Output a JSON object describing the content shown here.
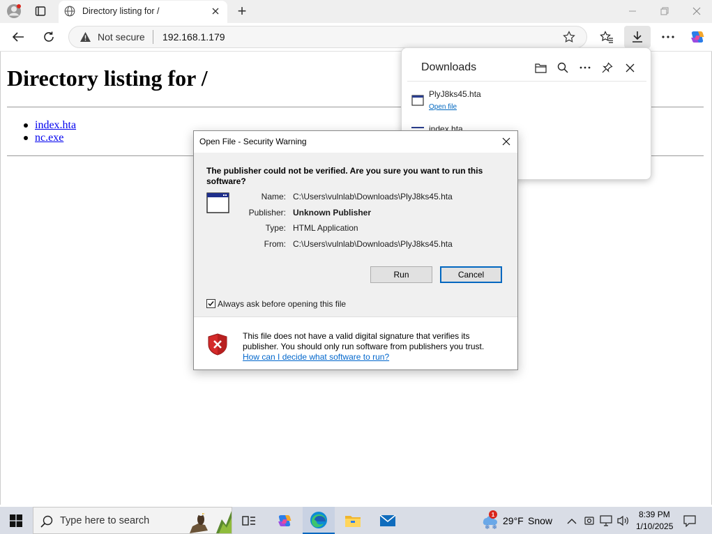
{
  "browser": {
    "tab_title": "Directory listing for /",
    "security_label": "Not secure",
    "url": "192.168.1.179",
    "new_tab_symbol": "+",
    "window_controls": [
      "minimize",
      "restore",
      "close"
    ]
  },
  "page": {
    "heading": "Directory listing for /",
    "files": [
      "index.hta",
      "nc.exe"
    ]
  },
  "downloads": {
    "title": "Downloads",
    "items": [
      {
        "name": "PlyJ8ks45.hta",
        "action": "Open file"
      },
      {
        "name": "index.hta"
      }
    ]
  },
  "dialog": {
    "title": "Open File - Security Warning",
    "question": "The publisher could not be verified.  Are you sure you want to run this software?",
    "fields": {
      "name_label": "Name:",
      "name_value": "C:\\Users\\vulnlab\\Downloads\\PlyJ8ks45.hta",
      "publisher_label": "Publisher:",
      "publisher_value": "Unknown Publisher",
      "type_label": "Type:",
      "type_value": "HTML Application",
      "from_label": "From:",
      "from_value": "C:\\Users\\vulnlab\\Downloads\\PlyJ8ks45.hta"
    },
    "run_label": "Run",
    "cancel_label": "Cancel",
    "checkbox_label": "Always ask before opening this file",
    "checkbox_checked": true,
    "warning_text": "This file does not have a valid digital signature that verifies its publisher.  You should only run software from publishers you trust.",
    "help_link": "How can I decide what software to run?"
  },
  "taskbar": {
    "search_placeholder": "Type here to search",
    "weather_temp": "29°F",
    "weather_desc": "Snow",
    "weather_badge": "1",
    "time": "8:39 PM",
    "date": "1/10/2025"
  },
  "colors": {
    "link": "#0000ee",
    "accent": "#0067c0",
    "shield_red": "#d42a2a"
  }
}
